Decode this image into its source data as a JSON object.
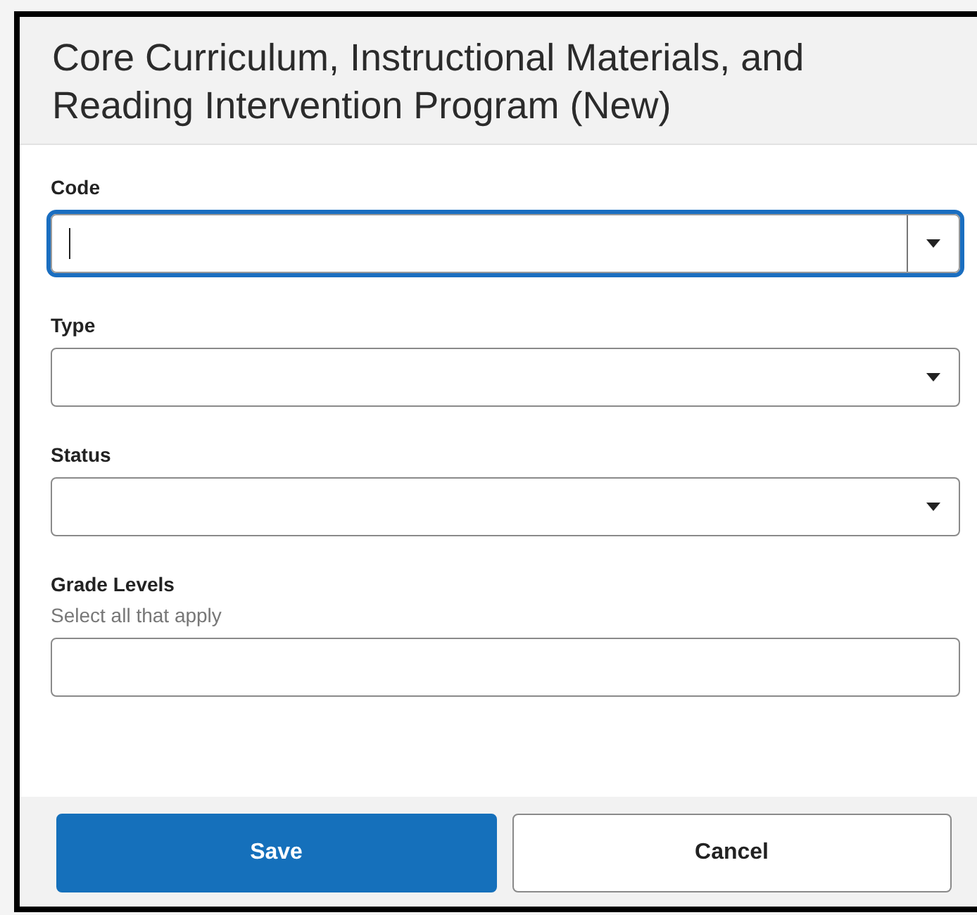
{
  "dialog": {
    "title": "Core Curriculum, Instructional Materials, and Reading Intervention Program (New)"
  },
  "fields": [
    {
      "label": "Code",
      "kind": "dropdown",
      "focused": true
    },
    {
      "label": "Type",
      "kind": "dropdown",
      "focused": false
    },
    {
      "label": "Status",
      "kind": "dropdown",
      "focused": false
    },
    {
      "label": "Grade Levels",
      "kind": "multiselect",
      "hint": "Select all that apply",
      "focused": false
    }
  ],
  "buttons": [
    {
      "label": "Save",
      "kind": "primary"
    },
    {
      "label": "Cancel",
      "kind": "secondary"
    }
  ]
}
